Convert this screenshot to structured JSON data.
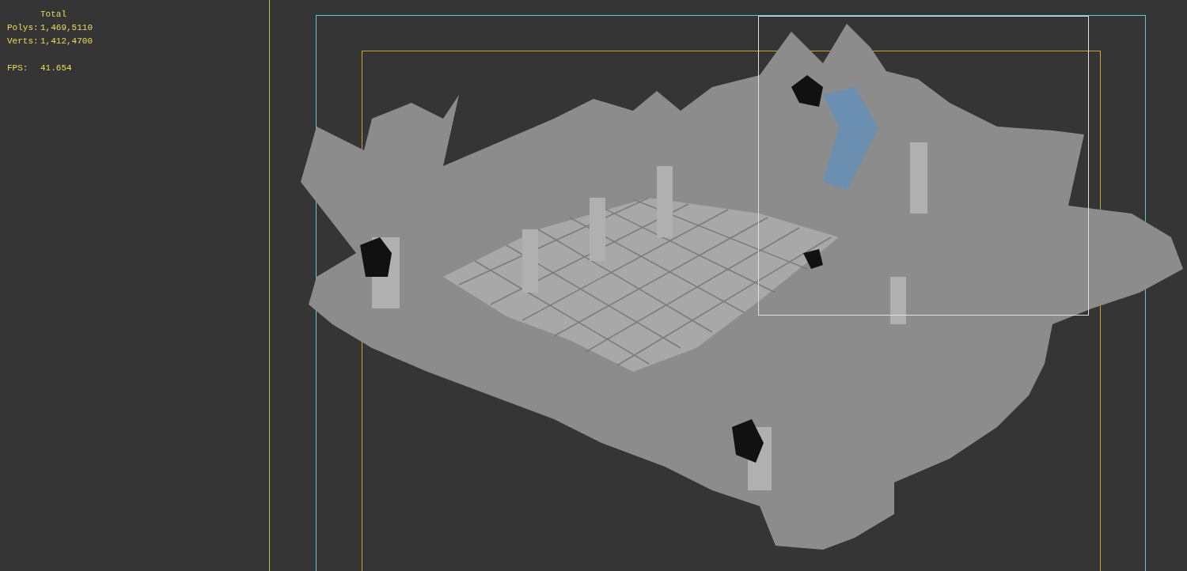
{
  "viewport_stats": {
    "header": "Total",
    "rows": [
      {
        "label": "Polys:",
        "value": "1,469,5110"
      },
      {
        "label": "Verts:",
        "value": "1,412,4700"
      }
    ],
    "fps": {
      "label": "FPS:",
      "value": "41.654"
    }
  }
}
